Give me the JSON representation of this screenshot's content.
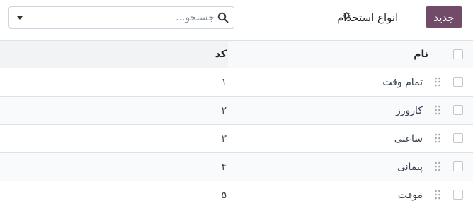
{
  "control_panel": {
    "new_button": "جدید",
    "title": "انواع استخدام",
    "search_placeholder": "جستجو..."
  },
  "table": {
    "columns": {
      "name": "نام",
      "code": "کد"
    },
    "rows": [
      {
        "name": "تمام وقت",
        "code": "۱"
      },
      {
        "name": "کارورز",
        "code": "۲"
      },
      {
        "name": "ساعتی",
        "code": "۳"
      },
      {
        "name": "پیمانی",
        "code": "۴"
      },
      {
        "name": "موقت",
        "code": "۵"
      }
    ]
  },
  "colors": {
    "primary": "#714b67",
    "header_bg": "#f1f3f5",
    "border": "#dee2e6"
  },
  "icons": [
    "gear-icon",
    "search-icon",
    "caret-down-icon",
    "drag-handle-icon"
  ]
}
